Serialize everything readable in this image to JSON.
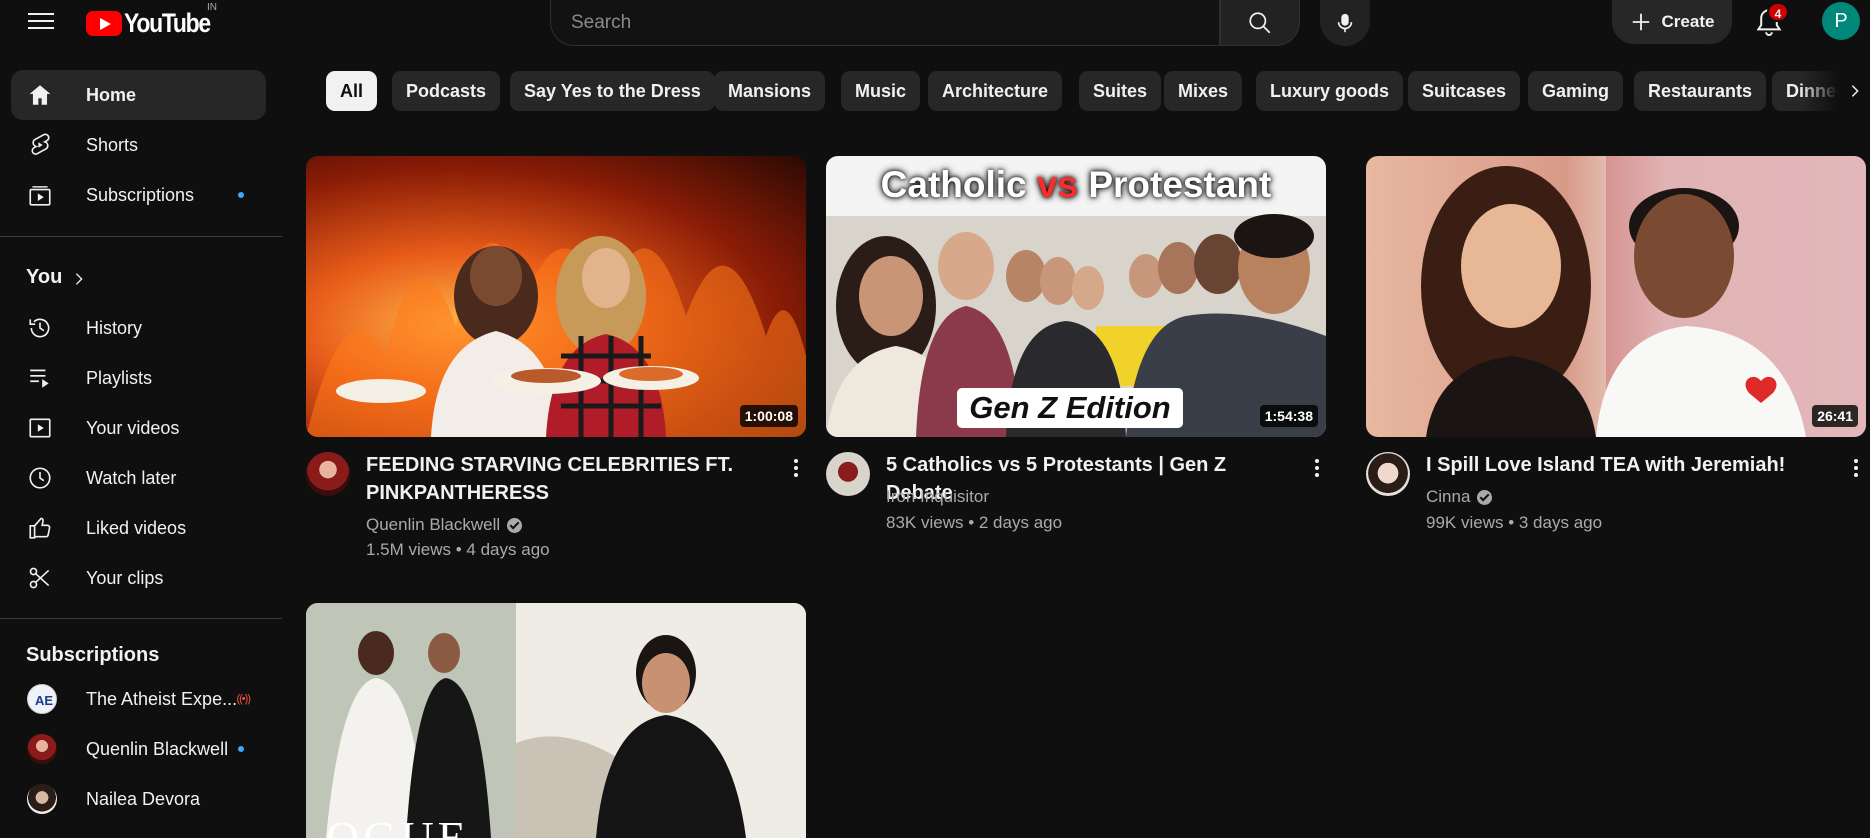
{
  "header": {
    "logo_text": "YouTube",
    "country_code": "IN",
    "search_placeholder": "Search",
    "create_label": "Create",
    "notification_count": "4",
    "user_initial": "P"
  },
  "sidebar": {
    "main": [
      {
        "label": "Home",
        "icon": "home-icon",
        "active": true
      },
      {
        "label": "Shorts",
        "icon": "shorts-icon"
      },
      {
        "label": "Subscriptions",
        "icon": "subscriptions-icon",
        "dot": true
      }
    ],
    "you_heading": "You",
    "you": [
      {
        "label": "History",
        "icon": "history-icon"
      },
      {
        "label": "Playlists",
        "icon": "playlists-icon"
      },
      {
        "label": "Your videos",
        "icon": "your-videos-icon"
      },
      {
        "label": "Watch later",
        "icon": "watch-later-icon"
      },
      {
        "label": "Liked videos",
        "icon": "thumbs-up-icon"
      },
      {
        "label": "Your clips",
        "icon": "scissors-icon"
      }
    ],
    "subscriptions_heading": "Subscriptions",
    "subscriptions": [
      {
        "label": "The Atheist Expe...",
        "badge": "live"
      },
      {
        "label": "Quenlin Blackwell",
        "badge": "dot"
      },
      {
        "label": "Nailea Devora",
        "badge": ""
      }
    ]
  },
  "chips": [
    "All",
    "Podcasts",
    "Say Yes to the Dress",
    "Mansions",
    "Music",
    "Architecture",
    "Suites",
    "Mixes",
    "Luxury goods",
    "Suitcases",
    "Gaming",
    "Restaurants",
    "Dinners"
  ],
  "videos": [
    {
      "title_line1": "FEEDING STARVING CELEBRITIES FT.",
      "title_line2": "PINKPANTHERESS",
      "channel": "Quenlin Blackwell",
      "verified": true,
      "meta": "1.5M views • 4 days ago",
      "duration": "1:00:08"
    },
    {
      "title_line1": "5 Catholics vs 5 Protestants | Gen Z Debate",
      "channel": "Iron Inquisitor",
      "verified": false,
      "meta": "83K views • 2 days ago",
      "duration": "1:54:38",
      "thumb_text_top_a": "Catholic ",
      "thumb_text_top_b": "vs",
      "thumb_text_top_c": " Protestant",
      "thumb_text_bottom": "Gen Z Edition"
    },
    {
      "title_line1": "I Spill Love Island TEA with Jeremiah!",
      "channel": "Cinna",
      "verified": true,
      "meta": "99K views • 3 days ago",
      "duration": "26:41"
    }
  ],
  "fourth_thumb_text": "OGUE",
  "colors": {
    "background": "#0f0f0f",
    "accent_red": "#ff0000",
    "chip_bg": "#272727",
    "blue_dot": "#3ea6ff"
  }
}
